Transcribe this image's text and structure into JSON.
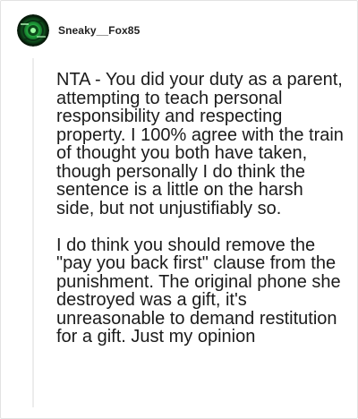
{
  "comment": {
    "author": {
      "username": "Sneaky__Fox85",
      "avatar_icon": "green-glitch-avatar-icon",
      "avatar_color": "#1f9e3a"
    },
    "paragraphs": [
      "NTA - You did your duty as a parent, attempting to teach personal responsibility and respecting property. I 100% agree with the train of thought you both have taken, though personally I do think the sentence is a little on the harsh side, but not unjustifiably so.",
      "I do think you should remove the \"pay you back first\" clause from the punishment. The original phone she destroyed was a gift, it's unreasonable to demand restitution for a gift. Just my opinion"
    ]
  }
}
